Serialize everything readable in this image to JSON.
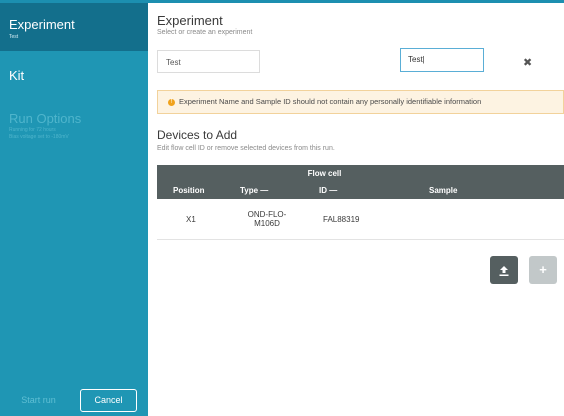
{
  "sidebar": {
    "items": [
      {
        "title": "Experiment",
        "subtitle": "Test"
      },
      {
        "title": "Kit"
      },
      {
        "title": "Run Options",
        "subtitle_1": "Running for 72 hours",
        "subtitle_2": "Bias voltage set to -180mV"
      }
    ],
    "start_label": "Start run",
    "cancel_label": "Cancel"
  },
  "experiment": {
    "heading": "Experiment",
    "subheading": "Select or create an experiment",
    "name_value": "Test"
  },
  "warning": {
    "text": "Experiment Name and Sample ID should not contain any personally identifiable information",
    "icon": "!"
  },
  "devices": {
    "heading": "Devices to Add",
    "subheading": "Edit flow cell ID or remove selected devices from this run.",
    "group_header": "Flow cell",
    "columns": [
      "Position",
      "Type —",
      "ID —",
      "Sample"
    ],
    "rows": [
      {
        "position": "X1",
        "type_line1": "OND-FLO-",
        "type_line2": "M106D",
        "id": "FAL88319",
        "sample": "Test|"
      }
    ]
  },
  "icons": {
    "remove": "✖",
    "upload": "⭱",
    "add": "+"
  },
  "colors": {
    "sidebar": "#1f96b4",
    "sidebar_active": "#136f8c",
    "table_header": "#555f60",
    "warning_bg": "#fdf3e2"
  }
}
